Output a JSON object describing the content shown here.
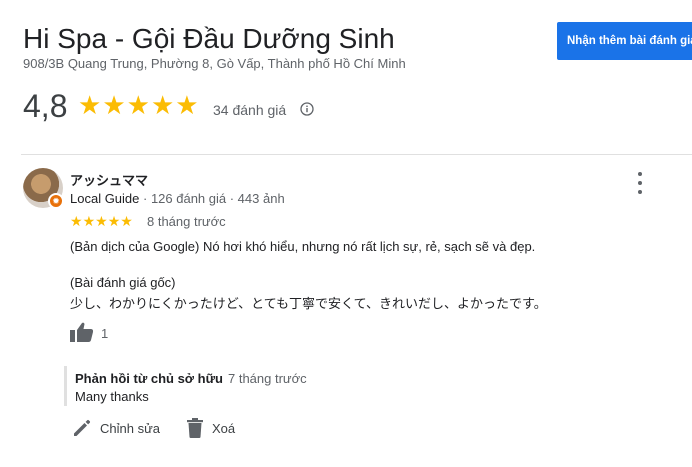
{
  "header": {
    "business_name": "Hi Spa - Gội Đầu Dưỡng Sinh",
    "address": "908/3B Quang Trung, Phường 8, Gò Vấp, Thành phố Hồ Chí Minh",
    "cta_label": "Nhận thêm bài đánh giá",
    "rating": "4,8",
    "rating_value": 4.8,
    "stars_max": 5,
    "review_count": "34 đánh giá",
    "star_color": "#fbbc04",
    "accent_color": "#1a73e8"
  },
  "review": {
    "author": "アッシュママ",
    "local_guide": "Local Guide",
    "author_stats": " · 126 đánh giá · 443 ảnh",
    "stars": 5,
    "time": "8 tháng trước",
    "translated": "(Bản dịch của Google) Nó hơi khó hiểu, nhưng nó rất lịch sự, rẻ, sạch sẽ và đẹp.",
    "original_label": "(Bài đánh giá gốc)",
    "original": "少し、わかりにくかったけど、とても丁寧で安くて、きれいだし、よかったです。",
    "likes": "1"
  },
  "owner_reply": {
    "label": "Phản hồi từ chủ sở hữu",
    "time": "7 tháng trước",
    "text": "Many thanks"
  },
  "actions": {
    "edit_label": "Chỉnh sửa",
    "delete_label": "Xoá"
  },
  "icons": {
    "info": "info-icon",
    "more": "more-vert-icon",
    "like": "thumb-up-icon",
    "edit": "pencil-icon",
    "delete": "trash-icon",
    "badge": "local-guide-badge-icon"
  }
}
